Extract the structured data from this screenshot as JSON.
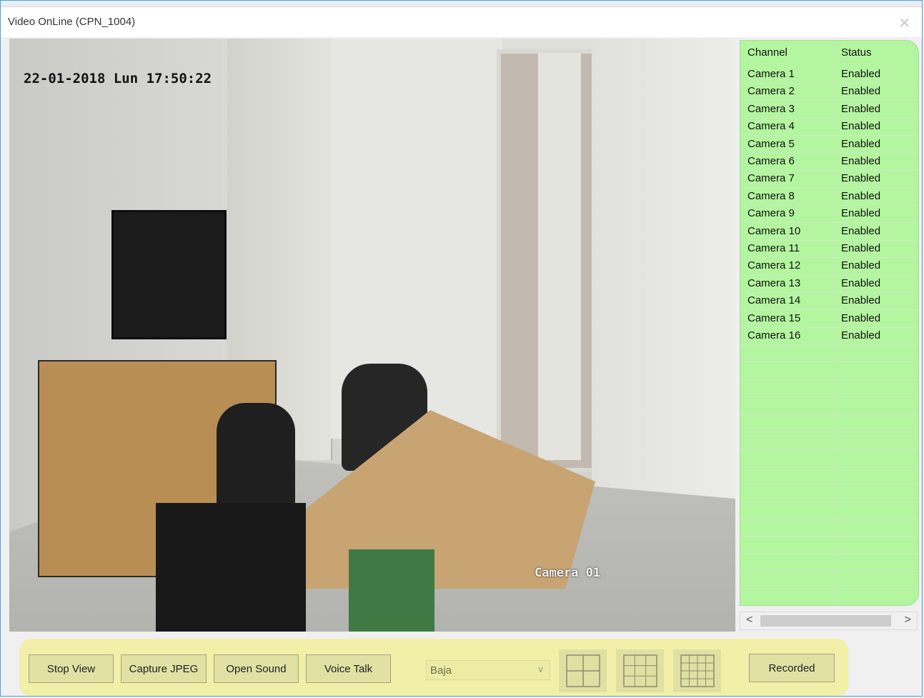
{
  "window": {
    "title": "Video OnLine (CPN_1004)",
    "close_icon": "close-icon"
  },
  "video": {
    "timestamp": "22-01-2018 Lun 17:50:22",
    "camera_label": "Camera 01"
  },
  "channel_list": {
    "headers": {
      "channel": "Channel",
      "status": "Status"
    },
    "rows": [
      {
        "channel": "Camera 1",
        "status": "Enabled"
      },
      {
        "channel": "Camera 2",
        "status": "Enabled"
      },
      {
        "channel": "Camera 3",
        "status": "Enabled"
      },
      {
        "channel": "Camera 4",
        "status": "Enabled"
      },
      {
        "channel": "Camera 5",
        "status": "Enabled"
      },
      {
        "channel": "Camera 6",
        "status": "Enabled"
      },
      {
        "channel": "Camera 7",
        "status": "Enabled"
      },
      {
        "channel": "Camera 8",
        "status": "Enabled"
      },
      {
        "channel": "Camera 9",
        "status": "Enabled"
      },
      {
        "channel": "Camera 10",
        "status": "Enabled"
      },
      {
        "channel": "Camera 11",
        "status": "Enabled"
      },
      {
        "channel": "Camera 12",
        "status": "Enabled"
      },
      {
        "channel": "Camera 13",
        "status": "Enabled"
      },
      {
        "channel": "Camera 14",
        "status": "Enabled"
      },
      {
        "channel": "Camera 15",
        "status": "Enabled"
      },
      {
        "channel": "Camera 16",
        "status": "Enabled"
      }
    ],
    "background_color": "#b4f5a0"
  },
  "toolbar": {
    "stop_view": "Stop View",
    "capture_jpeg": "Capture JPEG",
    "open_sound": "Open Sound",
    "voice_talk": "Voice Talk",
    "quality_select": "Baja",
    "recorded": "Recorded",
    "layout_icons": [
      "grid-2x2-icon",
      "grid-3x3-icon",
      "grid-4x4-icon"
    ],
    "background_color": "#f2f0a8"
  }
}
